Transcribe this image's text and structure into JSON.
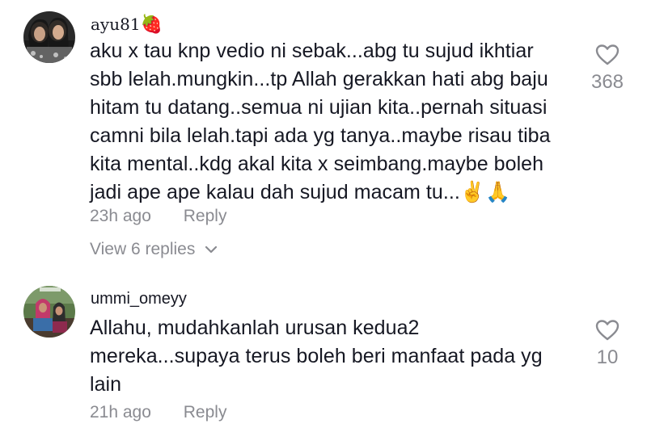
{
  "comments": [
    {
      "username": "ayu81",
      "username_emoji": "🍓",
      "text": "aku x tau knp vedio ni sebak...abg tu sujud ikhtiar sbb lelah.mungkin...tp Allah gerakkan hati abg baju hitam tu datang..semua ni ujian kita..pernah situasi camni bila lelah.tapi ada yg tanya..maybe risau tiba kita mental..kdg akal kita x seimbang.maybe boleh jadi ape ape kalau dah sujud macam tu...✌️🙏",
      "lines": [
        "aku x tau knp vedio ni sebak...abg tu sujud ikhtiar",
        "sbb lelah.mungkin...tp Allah gerakkan hati abg baju",
        "hitam tu datang..semua ni ujian kita..pernah situasi",
        "camni bila lelah.tapi ada yg tanya..maybe risau tiba",
        "kita mental..kdg akal kita x seimbang.maybe boleh",
        "jadi ape ape kalau dah sujud macam tu...✌️🙏"
      ],
      "time": "23h ago",
      "reply_label": "Reply",
      "likes": "368",
      "view_replies": "View 6 replies"
    },
    {
      "username": "ummi_omeyy",
      "text": "Allahu, mudahkanlah urusan kedua2 mereka...supaya terus boleh beri manfaat pada yg lain",
      "lines": [
        "Allahu, mudahkanlah urusan kedua2",
        "mereka...supaya terus boleh beri manfaat pada yg",
        "lain"
      ],
      "time": "21h ago",
      "reply_label": "Reply",
      "likes": "10"
    }
  ],
  "icons": {
    "like": "heart-outline-icon",
    "expand": "chevron-down-icon"
  },
  "colors": {
    "text": "#161823",
    "secondary": "#8a8b91"
  }
}
